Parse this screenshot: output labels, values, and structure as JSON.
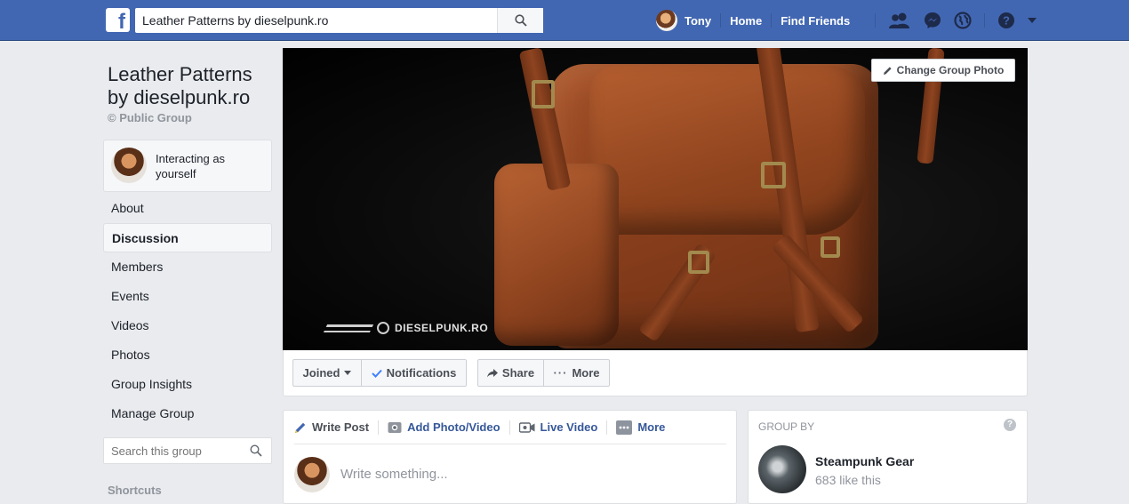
{
  "topbar": {
    "search_value": "Leather Patterns by dieselpunk.ro",
    "user_name": "Tony",
    "home_label": "Home",
    "find_friends_label": "Find Friends",
    "logo_letter": "f",
    "icons": [
      "friends-icon",
      "messenger-icon",
      "globe-icon",
      "help-icon",
      "chevron-down-icon"
    ]
  },
  "group": {
    "title": "Leather Patterns by dieselpunk.ro",
    "privacy": "© Public Group",
    "interacting_as": "Interacting as yourself"
  },
  "sidebar": {
    "items": [
      {
        "label": "About",
        "active": false
      },
      {
        "label": "Discussion",
        "active": true
      },
      {
        "label": "Members",
        "active": false
      },
      {
        "label": "Events",
        "active": false
      },
      {
        "label": "Videos",
        "active": false
      },
      {
        "label": "Photos",
        "active": false
      },
      {
        "label": "Group Insights",
        "active": false
      },
      {
        "label": "Manage Group",
        "active": false
      }
    ],
    "search_placeholder": "Search this group",
    "shortcuts_label": "Shortcuts"
  },
  "cover": {
    "watermark": "DIESELPUNK.RO",
    "change_photo_label": "Change Group Photo"
  },
  "actions": {
    "joined_label": "Joined",
    "notifications_label": "Notifications",
    "share_label": "Share",
    "more_label": "More"
  },
  "composer": {
    "write_post_label": "Write Post",
    "add_photo_label": "Add Photo/Video",
    "live_video_label": "Live Video",
    "more_label": "More",
    "placeholder": "Write something..."
  },
  "group_by": {
    "heading": "GROUP BY",
    "name": "Steampunk Gear",
    "likes": "683 like this"
  },
  "colors": {
    "brand_blue": "#4267b2",
    "link_blue": "#365899",
    "background": "#e9ebee",
    "check_blue": "#4080ff"
  }
}
